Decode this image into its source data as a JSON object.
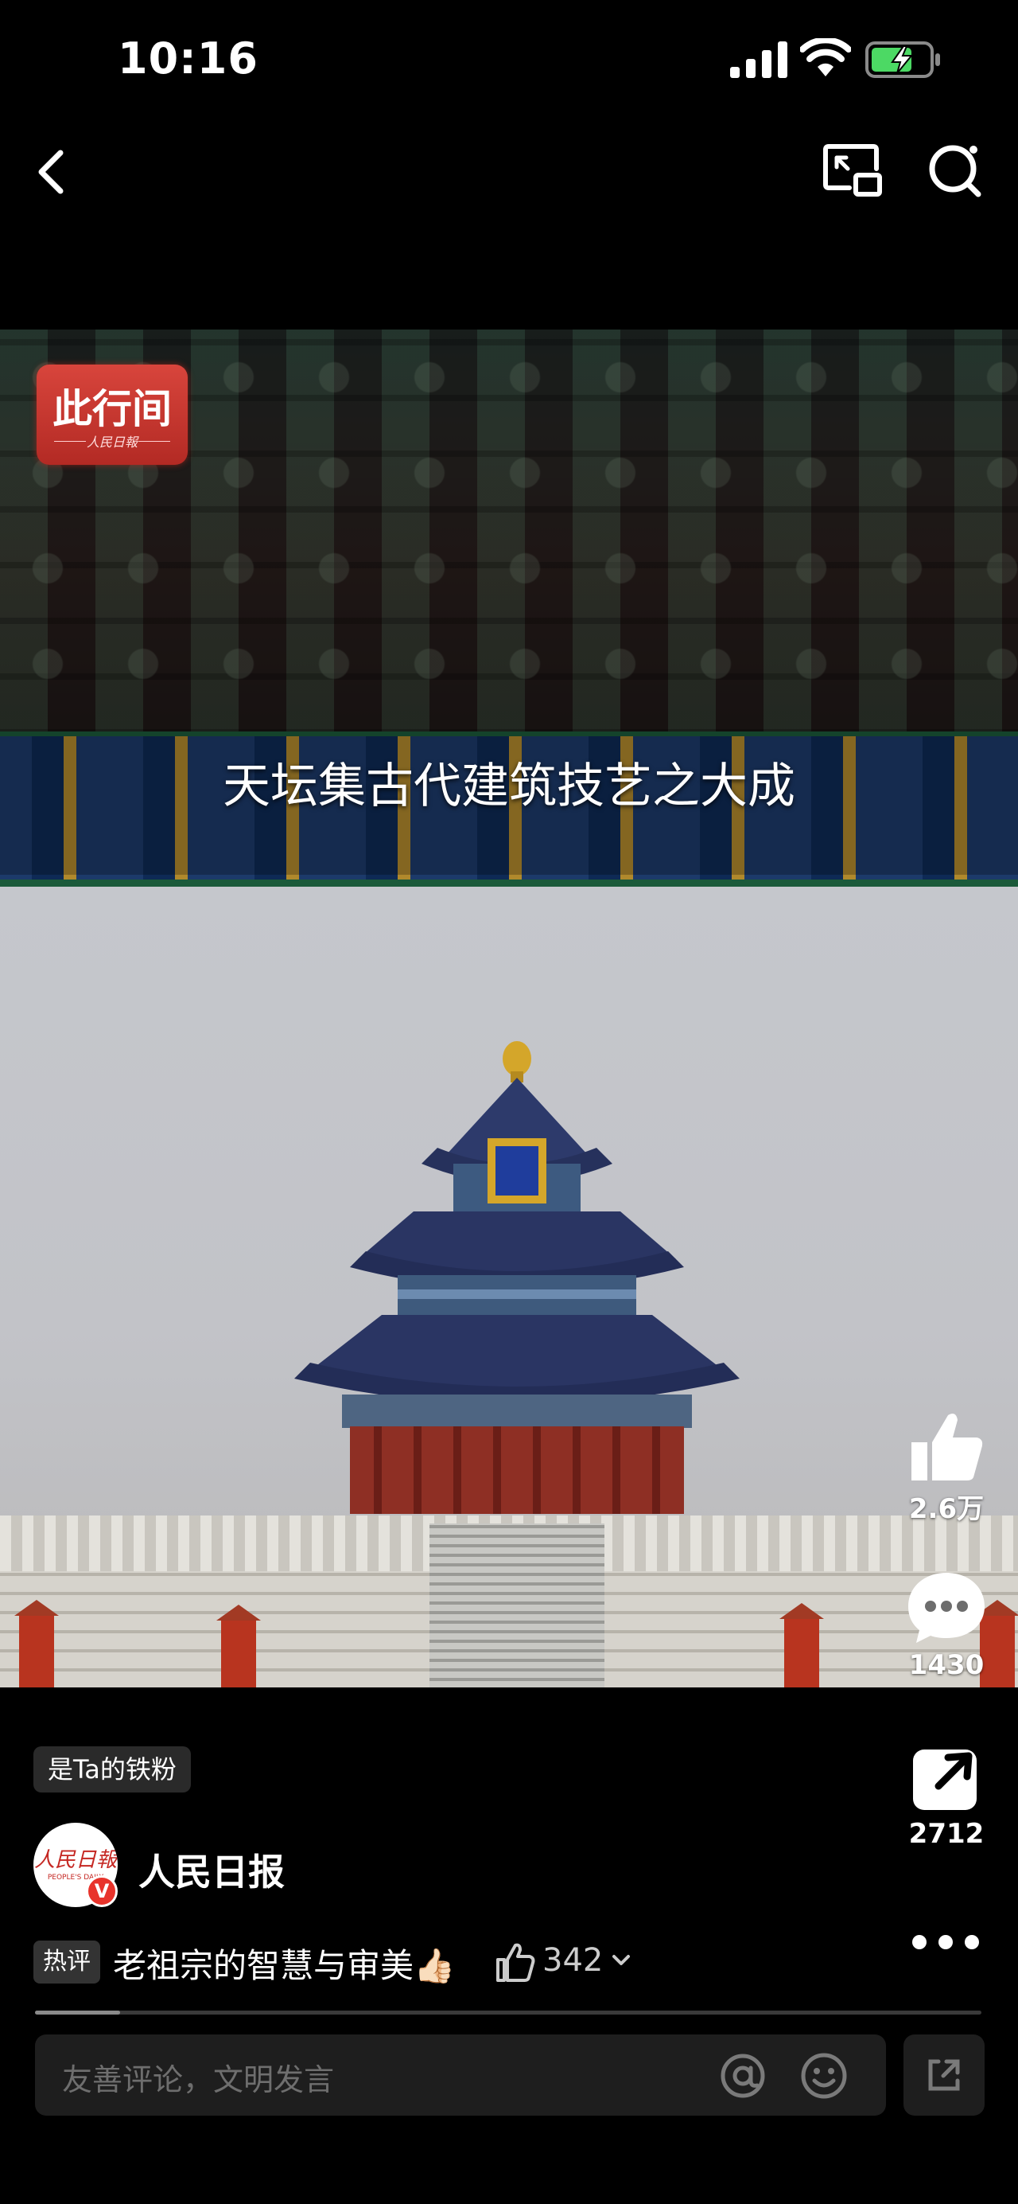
{
  "status_bar": {
    "time": "10:16"
  },
  "video": {
    "logo_text": "此行间",
    "logo_sub": "人民日報",
    "subtitle": "天坛集古代建筑技艺之大成"
  },
  "actions": {
    "like_count": "2.6万",
    "comment_count": "1430",
    "share_count": "2712"
  },
  "author": {
    "fan_badge": "是Ta的铁粉",
    "avatar_text": "人民日報",
    "avatar_sub": "PEOPLE'S DAILY",
    "verified_mark": "V",
    "name": "人民日报"
  },
  "hot_comment": {
    "tag": "热评",
    "text": "老祖宗的智慧与审美👍🏻",
    "likes": "342"
  },
  "progress": {
    "value": 0.09
  },
  "comment_input": {
    "placeholder": "友善评论，文明发言"
  }
}
